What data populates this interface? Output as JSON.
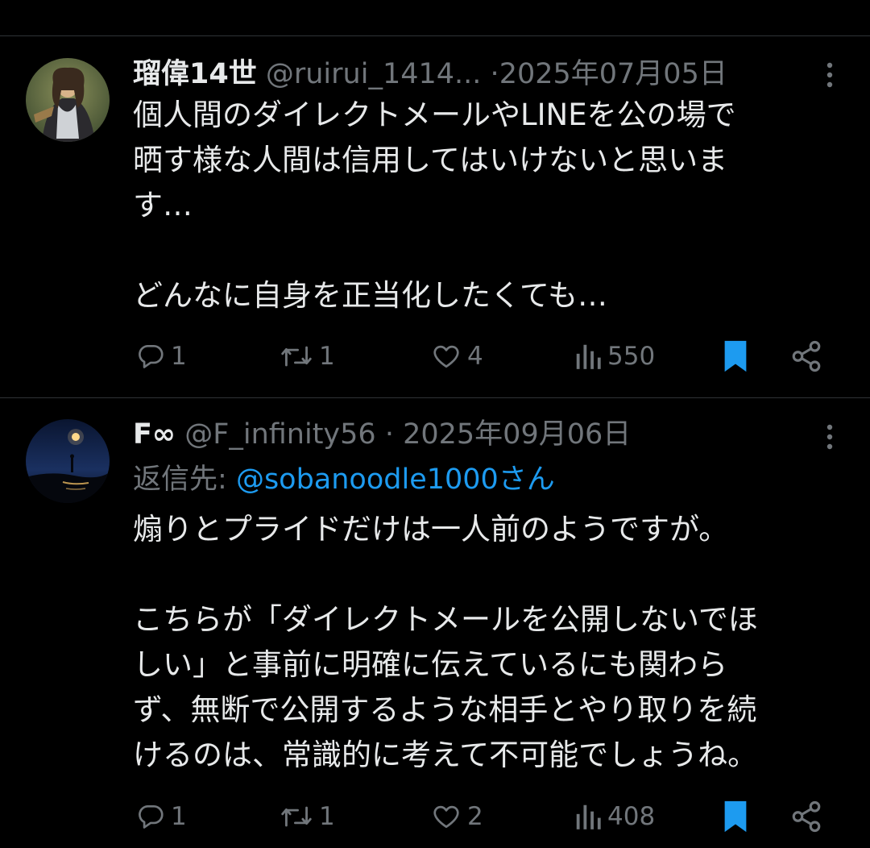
{
  "tweets": [
    {
      "display_name": "瑠偉14世",
      "handle": "@ruirui_1414...",
      "separator": "·",
      "date": "2025年07月05日",
      "text": "個人間のダイレクトメールやLINEを公の場で\n晒す様な人間は信用してはいけないと思いま\nす…\n\nどんなに自身を正当化したくても…",
      "reply_count": "1",
      "retweet_count": "1",
      "like_count": "4",
      "view_count": "550",
      "bookmarked": true,
      "avatar_icon": "portrait-avatar"
    },
    {
      "display_name": "F∞",
      "handle": "@F_infinity56",
      "separator": "·",
      "date": "2025年09月06日",
      "reply_label": "返信先:",
      "reply_mention": "@sobanoodle1000さん",
      "text": "煽りとプライドだけは一人前のようですが。\n\nこちらが「ダイレクトメールを公開しないでほ\nしい」と事前に明確に伝えているにも関わら\nず、無断で公開するような相手とやり取りを続\nけるのは、常識的に考えて不可能でしょうね。",
      "reply_count": "1",
      "retweet_count": "1",
      "like_count": "2",
      "view_count": "408",
      "bookmarked": true,
      "avatar_icon": "moon-landscape-avatar"
    }
  ],
  "colors": {
    "background": "#000000",
    "text": "#e7e9ea",
    "muted": "#71767b",
    "accent": "#1d9bf0",
    "divider": "#2f3336"
  }
}
